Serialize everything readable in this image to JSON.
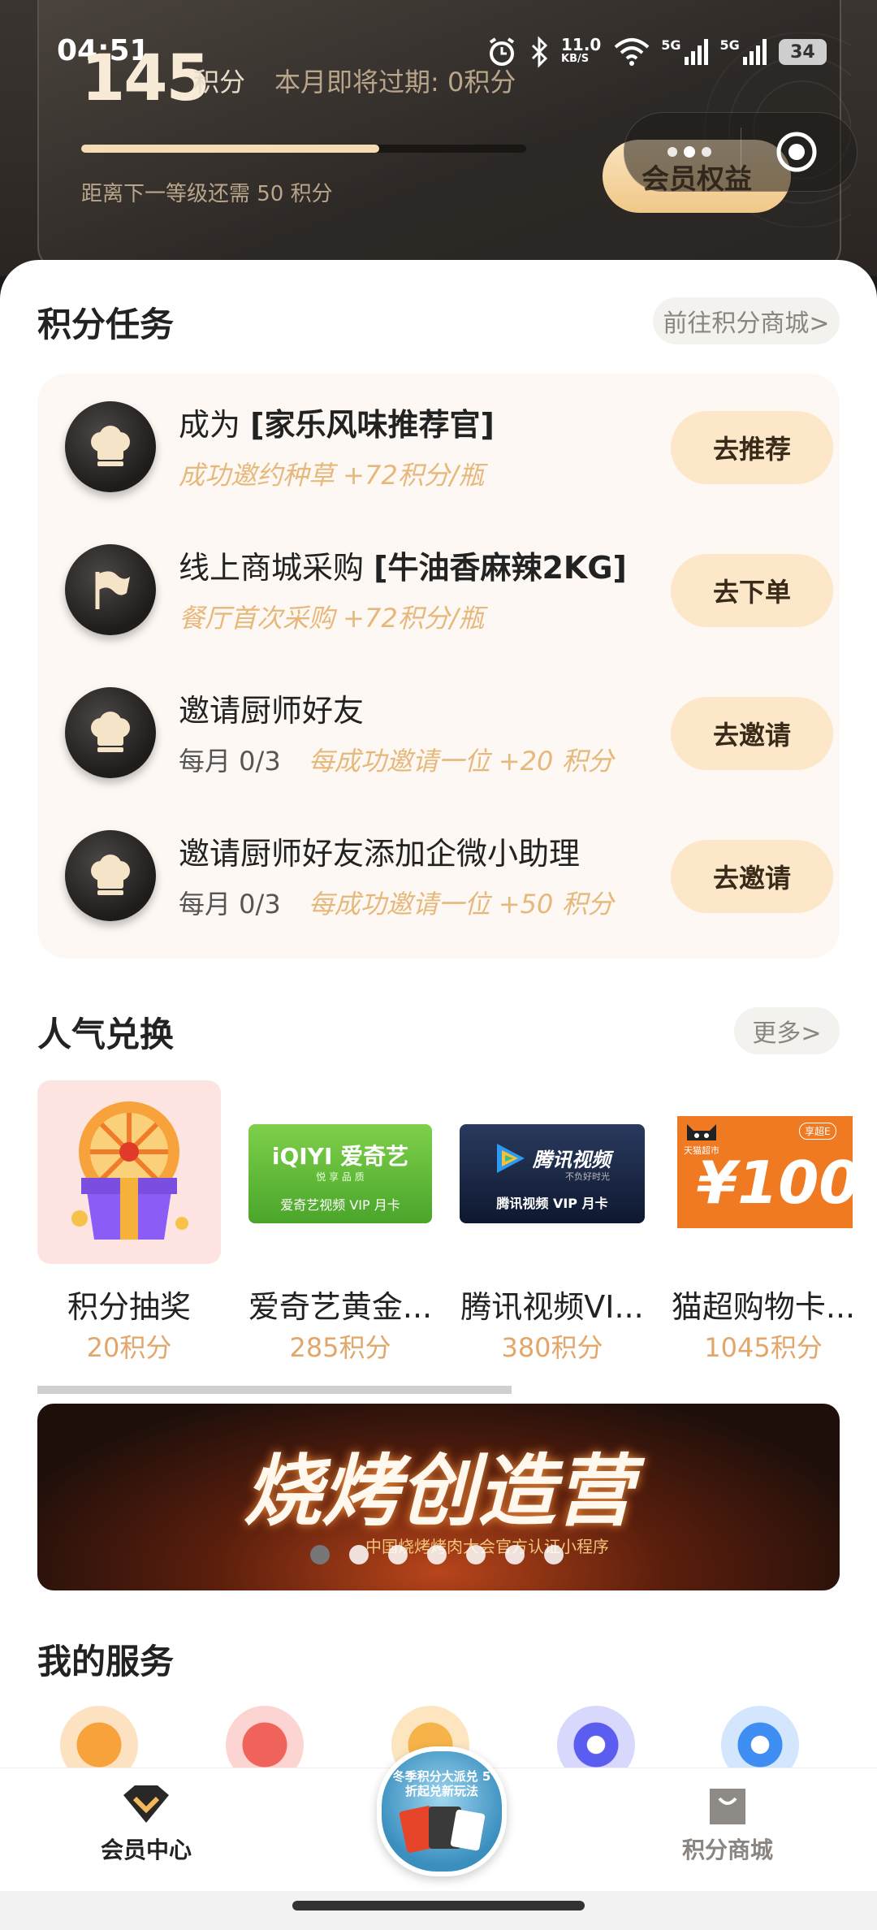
{
  "status_bar": {
    "time": "04:51",
    "speed": "11.0",
    "speed_unit": "KB/S",
    "net1": "5G",
    "net2": "5G",
    "battery": "34"
  },
  "header": {
    "points": "145",
    "points_unit": "积分",
    "expire_text": "本月即将过期: 0积分",
    "progress": 0.67,
    "next_level_text": "距离下一等级还需 50 积分",
    "benefits_label": "会员权益"
  },
  "tasks": {
    "title": "积分任务",
    "link_label": "前往积分商城>",
    "items": [
      {
        "title_prefix": "成为 ",
        "title_bold": "[家乐风味推荐官]",
        "count": "",
        "sub": "成功邀约种草 +72积分/瓶",
        "button": "去推荐",
        "icon": "chef-hat-icon"
      },
      {
        "title_prefix": "线上商城采购 ",
        "title_bold": "[牛油香麻辣2KG]",
        "count": "",
        "sub": "餐厅首次采购 +72积分/瓶",
        "button": "去下单",
        "icon": "flag-icon"
      },
      {
        "title_prefix": "邀请厨师好友",
        "title_bold": "",
        "count": "每月 0/3",
        "sub": "每成功邀请一位 +20 积分",
        "button": "去邀请",
        "icon": "chef-hat-icon"
      },
      {
        "title_prefix": "邀请厨师好友添加企微小助理",
        "title_bold": "",
        "count": "每月 0/3",
        "sub": "每成功邀请一位 +50 积分",
        "button": "去邀请",
        "icon": "chef-hat-icon"
      }
    ]
  },
  "exchange": {
    "title": "人气兑换",
    "more_label": "更多>",
    "items": [
      {
        "name": "积分抽奖",
        "price": "20积分",
        "art": "lottery-gift-icon"
      },
      {
        "name": "爱奇艺黄金...",
        "price": "285积分",
        "art": "iqiyi-card",
        "card_brand": "iQIYI 爱奇艺",
        "card_slogan": "悦 享 品 质",
        "card_text": "爱奇艺视频 VIP 月卡",
        "color": "#5fb93a"
      },
      {
        "name": "腾讯视频VI...",
        "price": "380积分",
        "art": "tencent-video-card",
        "card_brand": "腾讯视频",
        "card_slogan": "不负好时光",
        "card_text": "腾讯视频 VIP 月卡",
        "color": "#1c2a4a"
      },
      {
        "name": "猫超购物卡...",
        "price": "1045积分",
        "art": "tmall-card",
        "card_brand": "天猫超市",
        "card_tag": "享超E",
        "card_value": "¥100",
        "color": "#f07a22"
      }
    ]
  },
  "banner": {
    "title": "烧烤创造营",
    "subtitle": "中国烧烤烤肉大会官方认证小程序",
    "dots": 7
  },
  "services": {
    "title": "我的服务",
    "icons": [
      {
        "name": "star-badge-icon",
        "color": "#f6a24a"
      },
      {
        "name": "ticket-icon",
        "color": "#f0635a"
      },
      {
        "name": "play-icon",
        "color": "#f6b34a"
      },
      {
        "name": "record-icon",
        "color": "#5b5cf0"
      },
      {
        "name": "headset-icon",
        "color": "#3e8df2"
      }
    ]
  },
  "bottom_nav": {
    "left_label": "会员中心",
    "right_label": "积分商城",
    "center_promo": "冬季积分大派兑 5折起兑新玩法"
  }
}
